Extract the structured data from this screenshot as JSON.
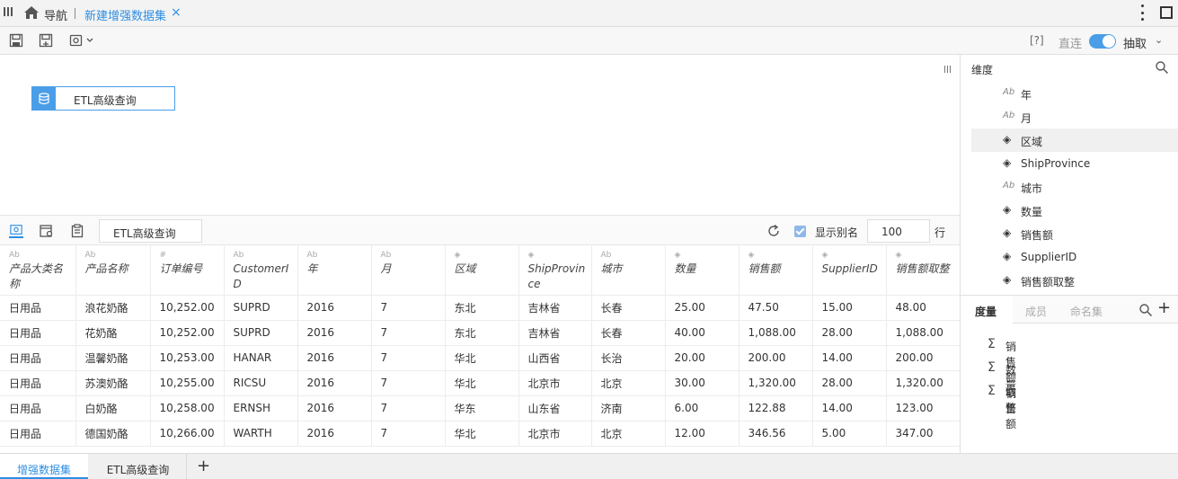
{
  "topbar": {
    "nav_label": "导航",
    "active_tab": "新建增强数据集",
    "close_glyph": "×"
  },
  "toolbar": {
    "icons": [
      "save-icon",
      "save-as-icon",
      "settings-icon"
    ],
    "help_label": "[?]",
    "direct_label": "直连",
    "toggle_on": true,
    "extract_label": "抽取",
    "accent": "#4a9ee8"
  },
  "canvas": {
    "node_label": "ETL高级查询"
  },
  "preview": {
    "name_field": "ETL高级查询",
    "show_alias_label": "显示别名",
    "show_alias_checked": true,
    "rows_value": "100",
    "rows_label": "行"
  },
  "table": {
    "columns": [
      {
        "label": "产品大类名称",
        "type": "text"
      },
      {
        "label": "产品名称",
        "type": "text"
      },
      {
        "label": "订单编号",
        "type": "number"
      },
      {
        "label": "CustomerID",
        "type": "text"
      },
      {
        "label": "年",
        "type": "text"
      },
      {
        "label": "月",
        "type": "text"
      },
      {
        "label": "区域",
        "type": "geo"
      },
      {
        "label": "ShipProvince",
        "type": "geo"
      },
      {
        "label": "城市",
        "type": "text"
      },
      {
        "label": "数量",
        "type": "geo"
      },
      {
        "label": "销售额",
        "type": "geo"
      },
      {
        "label": "SupplierID",
        "type": "geo"
      },
      {
        "label": "销售额取整",
        "type": "geo"
      }
    ],
    "rows": [
      [
        "日用品",
        "浪花奶酪",
        "10,252.00",
        "SUPRD",
        "2016",
        "7",
        "东北",
        "吉林省",
        "长春",
        "25.00",
        "47.50",
        "15.00",
        "48.00"
      ],
      [
        "日用品",
        "花奶酪",
        "10,252.00",
        "SUPRD",
        "2016",
        "7",
        "东北",
        "吉林省",
        "长春",
        "40.00",
        "1,088.00",
        "28.00",
        "1,088.00"
      ],
      [
        "日用品",
        "温馨奶酪",
        "10,253.00",
        "HANAR",
        "2016",
        "7",
        "华北",
        "山西省",
        "长治",
        "20.00",
        "200.00",
        "14.00",
        "200.00"
      ],
      [
        "日用品",
        "苏澳奶酪",
        "10,255.00",
        "RICSU",
        "2016",
        "7",
        "华北",
        "北京市",
        "北京",
        "30.00",
        "1,320.00",
        "28.00",
        "1,320.00"
      ],
      [
        "日用品",
        "白奶酪",
        "10,258.00",
        "ERNSH",
        "2016",
        "7",
        "华东",
        "山东省",
        "济南",
        "6.00",
        "122.88",
        "14.00",
        "123.00"
      ],
      [
        "日用品",
        "德国奶酪",
        "10,266.00",
        "WARTH",
        "2016",
        "7",
        "华北",
        "北京市",
        "北京",
        "12.00",
        "346.56",
        "5.00",
        "347.00"
      ]
    ]
  },
  "dimensions": {
    "title": "维度",
    "items": [
      {
        "label": "年",
        "icon": "text-field-icon"
      },
      {
        "label": "月",
        "icon": "text-field-icon"
      },
      {
        "label": "区域",
        "icon": "geo-field-icon",
        "selected": true
      },
      {
        "label": "ShipProvince",
        "icon": "geo-field-icon"
      },
      {
        "label": "城市",
        "icon": "text-field-icon"
      },
      {
        "label": "数量",
        "icon": "geo-field-icon"
      },
      {
        "label": "销售额",
        "icon": "geo-field-icon"
      },
      {
        "label": "SupplierID",
        "icon": "geo-field-icon"
      },
      {
        "label": "销售额取整",
        "icon": "geo-field-icon"
      }
    ]
  },
  "measures": {
    "tabs": [
      "度量",
      "成员",
      "命名集"
    ],
    "items": [
      "销售额取整",
      "数量",
      "销售额"
    ]
  },
  "bottom_tabs": {
    "active": "增强数据集",
    "other": "ETL高级查询",
    "add_glyph": "+"
  }
}
